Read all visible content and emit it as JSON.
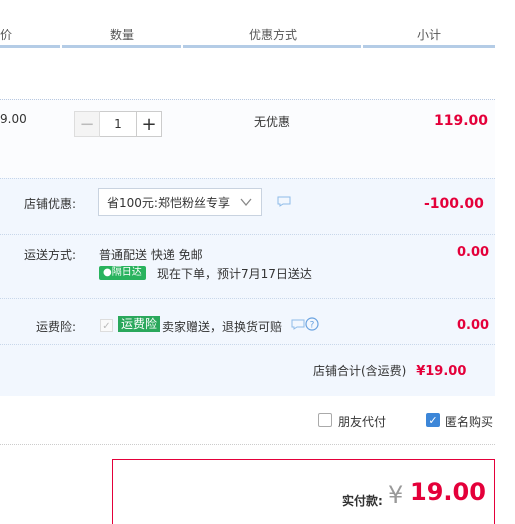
{
  "header": {
    "col_price": "价",
    "col_qty": "数量",
    "col_promo": "优惠方式",
    "col_subtotal": "小计"
  },
  "item": {
    "price_partial": "9.00",
    "quantity": "1",
    "minus": "−",
    "plus": "+",
    "promo": "无优惠",
    "subtotal": "119.00"
  },
  "shop": {
    "discount_label": "店铺优惠:",
    "discount_selected": "省100元:郑恺粉丝专享",
    "discount_amount": "-100.00",
    "shipping_label": "运送方式:",
    "shipping_method": "普通配送 快递 免邮",
    "next_day_badge": "隔日达",
    "delivery_note": "现在下单，预计7月17日送达",
    "shipping_fee": "0.00",
    "insurance_label": "运费险:",
    "insurance_tag": "运费险",
    "insurance_desc": "卖家赠送，退换货可赔",
    "insurance_fee": "0.00",
    "total_label": "店铺合计(含运费)",
    "total_value": "¥19.00"
  },
  "options": {
    "friend_pay": "朋友代付",
    "anonymous": "匿名购买"
  },
  "payment": {
    "label": "实付款:",
    "currency": "¥",
    "amount": "19.00"
  },
  "colors": {
    "price_red": "#e4003a",
    "checkbox_blue": "#3c86d8",
    "badge_green": "#29b35e",
    "section_bg": "#f2f7fe"
  }
}
